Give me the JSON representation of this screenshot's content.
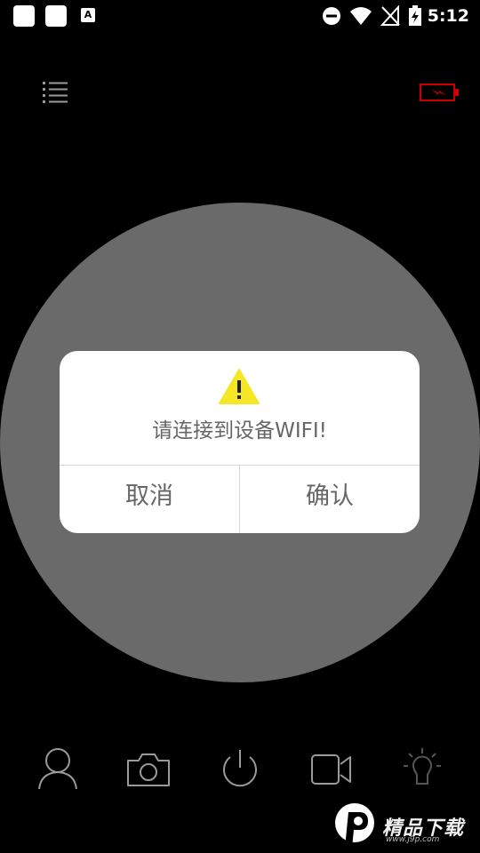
{
  "status_bar": {
    "time": "5:12",
    "notification_badge": "A",
    "icons": [
      "app-notification-icon",
      "app-notification-icon",
      "accessibility-icon",
      "do-not-disturb-icon",
      "wifi-icon",
      "no-signal-icon",
      "battery-charging-icon"
    ]
  },
  "header": {
    "menu_icon": "list-menu-icon",
    "device_battery_icon": "battery-low-icon",
    "colors": {
      "battery": "#cc0000"
    }
  },
  "dialog": {
    "icon": "warning-icon",
    "message": "请连接到设备WIFI!",
    "cancel_label": "取消",
    "confirm_label": "确认",
    "colors": {
      "warning": "#f5e626",
      "text": "#666666"
    }
  },
  "toolbar": {
    "items": [
      "profile-icon",
      "camera-icon",
      "power-icon",
      "video-icon",
      "light-bulb-icon"
    ]
  },
  "watermark": {
    "text": "精品下载",
    "sub": "www.j9p.com"
  }
}
